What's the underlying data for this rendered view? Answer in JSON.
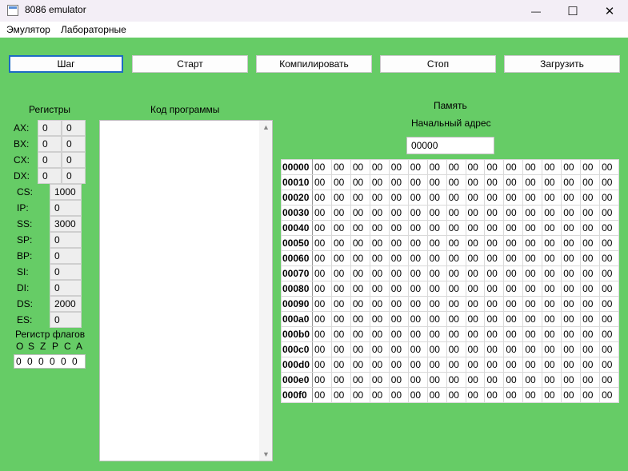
{
  "window": {
    "title": "8086 emulator",
    "minimize_glyph": "—",
    "maximize_glyph": "☐",
    "close_glyph": "✕"
  },
  "menu": [
    "Эмулятор",
    "Лабораторные"
  ],
  "toolbar": {
    "buttons": [
      "Шаг",
      "Старт",
      "Компилировать",
      "Стоп",
      "Загрузить"
    ]
  },
  "registers": {
    "title": "Регистры",
    "general": [
      {
        "name": "AX:",
        "hi": "0",
        "lo": "0"
      },
      {
        "name": "BX:",
        "hi": "0",
        "lo": "0"
      },
      {
        "name": "CX:",
        "hi": "0",
        "lo": "0"
      },
      {
        "name": "DX:",
        "hi": "0",
        "lo": "0"
      }
    ],
    "special": [
      {
        "name": "CS:",
        "value": "1000"
      },
      {
        "name": "IP:",
        "value": "0"
      },
      {
        "name": "SS:",
        "value": "3000"
      },
      {
        "name": "SP:",
        "value": "0"
      },
      {
        "name": "BP:",
        "value": "0"
      },
      {
        "name": "SI:",
        "value": "0"
      },
      {
        "name": "DI:",
        "value": "0"
      },
      {
        "name": "DS:",
        "value": "2000"
      },
      {
        "name": "ES:",
        "value": "0"
      }
    ]
  },
  "flags": {
    "title": "Регистр флагов",
    "names": [
      "O",
      "S",
      "Z",
      "P",
      "C",
      "A"
    ],
    "values": [
      "0",
      "0",
      "0",
      "0",
      "0",
      "0"
    ]
  },
  "code": {
    "title": "Код программы"
  },
  "memory": {
    "title": "Память",
    "start_label": "Начальный адрес",
    "start_address": "00000",
    "rows": [
      {
        "addr": "00000",
        "bytes": [
          "00",
          "00",
          "00",
          "00",
          "00",
          "00",
          "00",
          "00",
          "00",
          "00",
          "00",
          "00",
          "00",
          "00",
          "00",
          "00"
        ]
      },
      {
        "addr": "00010",
        "bytes": [
          "00",
          "00",
          "00",
          "00",
          "00",
          "00",
          "00",
          "00",
          "00",
          "00",
          "00",
          "00",
          "00",
          "00",
          "00",
          "00"
        ]
      },
      {
        "addr": "00020",
        "bytes": [
          "00",
          "00",
          "00",
          "00",
          "00",
          "00",
          "00",
          "00",
          "00",
          "00",
          "00",
          "00",
          "00",
          "00",
          "00",
          "00"
        ]
      },
      {
        "addr": "00030",
        "bytes": [
          "00",
          "00",
          "00",
          "00",
          "00",
          "00",
          "00",
          "00",
          "00",
          "00",
          "00",
          "00",
          "00",
          "00",
          "00",
          "00"
        ]
      },
      {
        "addr": "00040",
        "bytes": [
          "00",
          "00",
          "00",
          "00",
          "00",
          "00",
          "00",
          "00",
          "00",
          "00",
          "00",
          "00",
          "00",
          "00",
          "00",
          "00"
        ]
      },
      {
        "addr": "00050",
        "bytes": [
          "00",
          "00",
          "00",
          "00",
          "00",
          "00",
          "00",
          "00",
          "00",
          "00",
          "00",
          "00",
          "00",
          "00",
          "00",
          "00"
        ]
      },
      {
        "addr": "00060",
        "bytes": [
          "00",
          "00",
          "00",
          "00",
          "00",
          "00",
          "00",
          "00",
          "00",
          "00",
          "00",
          "00",
          "00",
          "00",
          "00",
          "00"
        ]
      },
      {
        "addr": "00070",
        "bytes": [
          "00",
          "00",
          "00",
          "00",
          "00",
          "00",
          "00",
          "00",
          "00",
          "00",
          "00",
          "00",
          "00",
          "00",
          "00",
          "00"
        ]
      },
      {
        "addr": "00080",
        "bytes": [
          "00",
          "00",
          "00",
          "00",
          "00",
          "00",
          "00",
          "00",
          "00",
          "00",
          "00",
          "00",
          "00",
          "00",
          "00",
          "00"
        ]
      },
      {
        "addr": "00090",
        "bytes": [
          "00",
          "00",
          "00",
          "00",
          "00",
          "00",
          "00",
          "00",
          "00",
          "00",
          "00",
          "00",
          "00",
          "00",
          "00",
          "00"
        ]
      },
      {
        "addr": "000a0",
        "bytes": [
          "00",
          "00",
          "00",
          "00",
          "00",
          "00",
          "00",
          "00",
          "00",
          "00",
          "00",
          "00",
          "00",
          "00",
          "00",
          "00"
        ]
      },
      {
        "addr": "000b0",
        "bytes": [
          "00",
          "00",
          "00",
          "00",
          "00",
          "00",
          "00",
          "00",
          "00",
          "00",
          "00",
          "00",
          "00",
          "00",
          "00",
          "00"
        ]
      },
      {
        "addr": "000c0",
        "bytes": [
          "00",
          "00",
          "00",
          "00",
          "00",
          "00",
          "00",
          "00",
          "00",
          "00",
          "00",
          "00",
          "00",
          "00",
          "00",
          "00"
        ]
      },
      {
        "addr": "000d0",
        "bytes": [
          "00",
          "00",
          "00",
          "00",
          "00",
          "00",
          "00",
          "00",
          "00",
          "00",
          "00",
          "00",
          "00",
          "00",
          "00",
          "00"
        ]
      },
      {
        "addr": "000e0",
        "bytes": [
          "00",
          "00",
          "00",
          "00",
          "00",
          "00",
          "00",
          "00",
          "00",
          "00",
          "00",
          "00",
          "00",
          "00",
          "00",
          "00"
        ]
      },
      {
        "addr": "000f0",
        "bytes": [
          "00",
          "00",
          "00",
          "00",
          "00",
          "00",
          "00",
          "00",
          "00",
          "00",
          "00",
          "00",
          "00",
          "00",
          "00",
          "00"
        ]
      }
    ]
  },
  "colors": {
    "background": "#66cc66",
    "focus": "#1e6bc4"
  }
}
